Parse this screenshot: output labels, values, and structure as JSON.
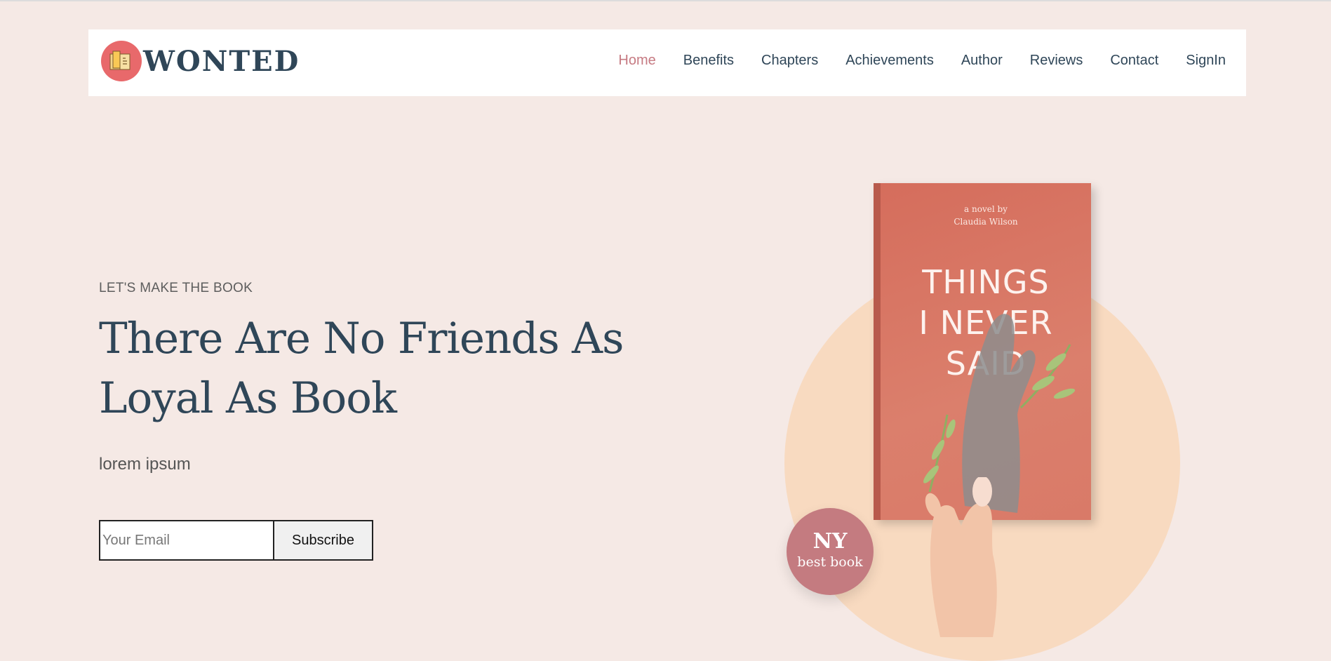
{
  "brand": {
    "name": "WONTED"
  },
  "nav": {
    "items": [
      {
        "label": "Home"
      },
      {
        "label": "Benefits"
      },
      {
        "label": "Chapters"
      },
      {
        "label": "Achievements"
      },
      {
        "label": "Author"
      },
      {
        "label": "Reviews"
      },
      {
        "label": "Contact"
      },
      {
        "label": "SignIn"
      }
    ],
    "active_color": "#c67a82",
    "text_color": "#2f4658"
  },
  "hero": {
    "kicker": "LET'S MAKE THE BOOK",
    "headline_line1": "There Are No Friends As",
    "headline_line2": "Loyal As Book",
    "subtitle": "lorem ipsum",
    "email_placeholder": "Your Email",
    "subscribe_label": "Subscribe"
  },
  "book": {
    "byline_line1": "a novel by",
    "byline_line2": "Claudia Wilson",
    "title_line1": "THINGS",
    "title_line2": "I NEVER",
    "title_line3": "SAID"
  },
  "badge": {
    "main": "NY",
    "sub": "best book"
  },
  "colors": {
    "background": "#f5e9e5",
    "headline": "#2f4658",
    "circle": "#f8dac0",
    "badge": "#c47b80",
    "book_cover": "#d56d5c"
  }
}
